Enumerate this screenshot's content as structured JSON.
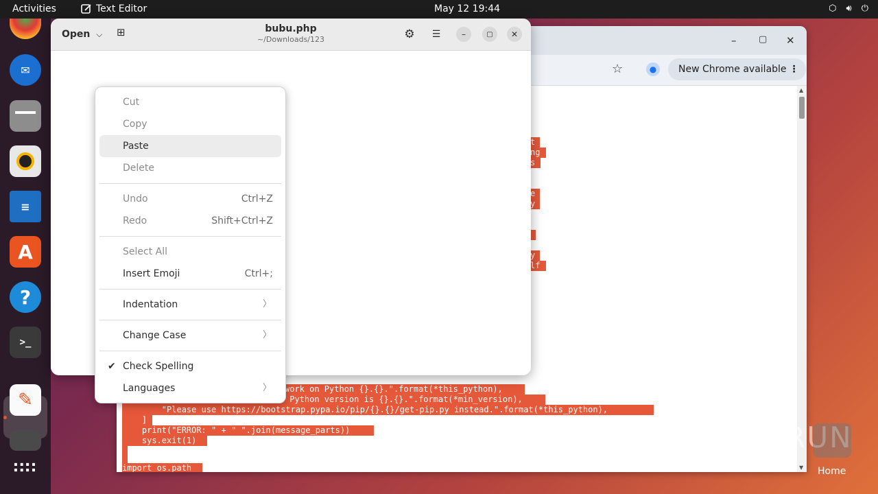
{
  "topbar": {
    "activities": "Activities",
    "app_name": "Text Editor",
    "clock": "May 12  19:44"
  },
  "dock": {
    "items": [
      "chrome-icon",
      "thunderbird-icon",
      "files-icon",
      "rhythmbox-icon",
      "writer-icon",
      "app-center-icon",
      "help-icon",
      "terminal-icon",
      "text-editor-icon",
      "disk-icon",
      "app-grid-icon"
    ]
  },
  "chrome": {
    "new_chrome": "New Chrome available",
    "code_lines": [
      "t",
      "ng",
      "s",
      "e",
      "y",
      "",
      "y",
      "lf",
      "work on Python {}.{}.\".format(*this_python),",
      " Python version is {}.{}.\".format(*min_version),",
      "        \"Please use https://bootstrap.pypa.io/pip/{}.{}/get-pip.py instead.\".format(*this_python),",
      "    ]",
      "    print(\"ERROR: \" + \" \".join(message_parts))",
      "    sys.exit(1)",
      "import os.path"
    ]
  },
  "editor": {
    "open_label": "Open",
    "title": "bubu.php",
    "subtitle": "~/Downloads/123"
  },
  "menu": {
    "cut": "Cut",
    "copy": "Copy",
    "paste": "Paste",
    "delete": "Delete",
    "undo": "Undo",
    "undo_accel": "Ctrl+Z",
    "redo": "Redo",
    "redo_accel": "Shift+Ctrl+Z",
    "select_all": "Select All",
    "insert_emoji": "Insert Emoji",
    "insert_emoji_accel": "Ctrl+;",
    "indentation": "Indentation",
    "change_case": "Change Case",
    "check_spelling": "Check Spelling",
    "languages": "Languages"
  },
  "desktop": {
    "watermark": "ANY RUN",
    "home_label": "Home"
  }
}
